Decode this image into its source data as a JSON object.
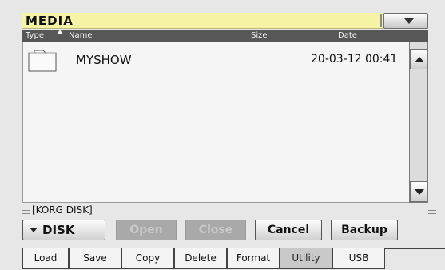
{
  "title": "MEDIA",
  "list": {
    "headers": {
      "type": "Type",
      "name": "Name",
      "size": "Size",
      "date": "Date"
    },
    "rows": [
      {
        "name": "MYSHOW",
        "size": "",
        "date": "20-03-12 00:41",
        "icon": "folder-icon"
      }
    ]
  },
  "path": "[KORG DISK]",
  "buttons": {
    "disk": "DISK",
    "open": "Open",
    "close": "Close",
    "cancel": "Cancel",
    "backup": "Backup"
  },
  "tabs": [
    {
      "label": "Load",
      "active": false
    },
    {
      "label": "Save",
      "active": false
    },
    {
      "label": "Copy",
      "active": false
    },
    {
      "label": "Delete",
      "active": false
    },
    {
      "label": "Format",
      "active": false
    },
    {
      "label": "Utility",
      "active": true
    },
    {
      "label": "USB",
      "active": false
    }
  ],
  "colors": {
    "title_bg": "#f6f3a4",
    "header_bg": "#575757",
    "list_bg": "#f5f5f5",
    "disabled_btn": "#a9a9a9",
    "active_tab": "#c9c9c9"
  }
}
